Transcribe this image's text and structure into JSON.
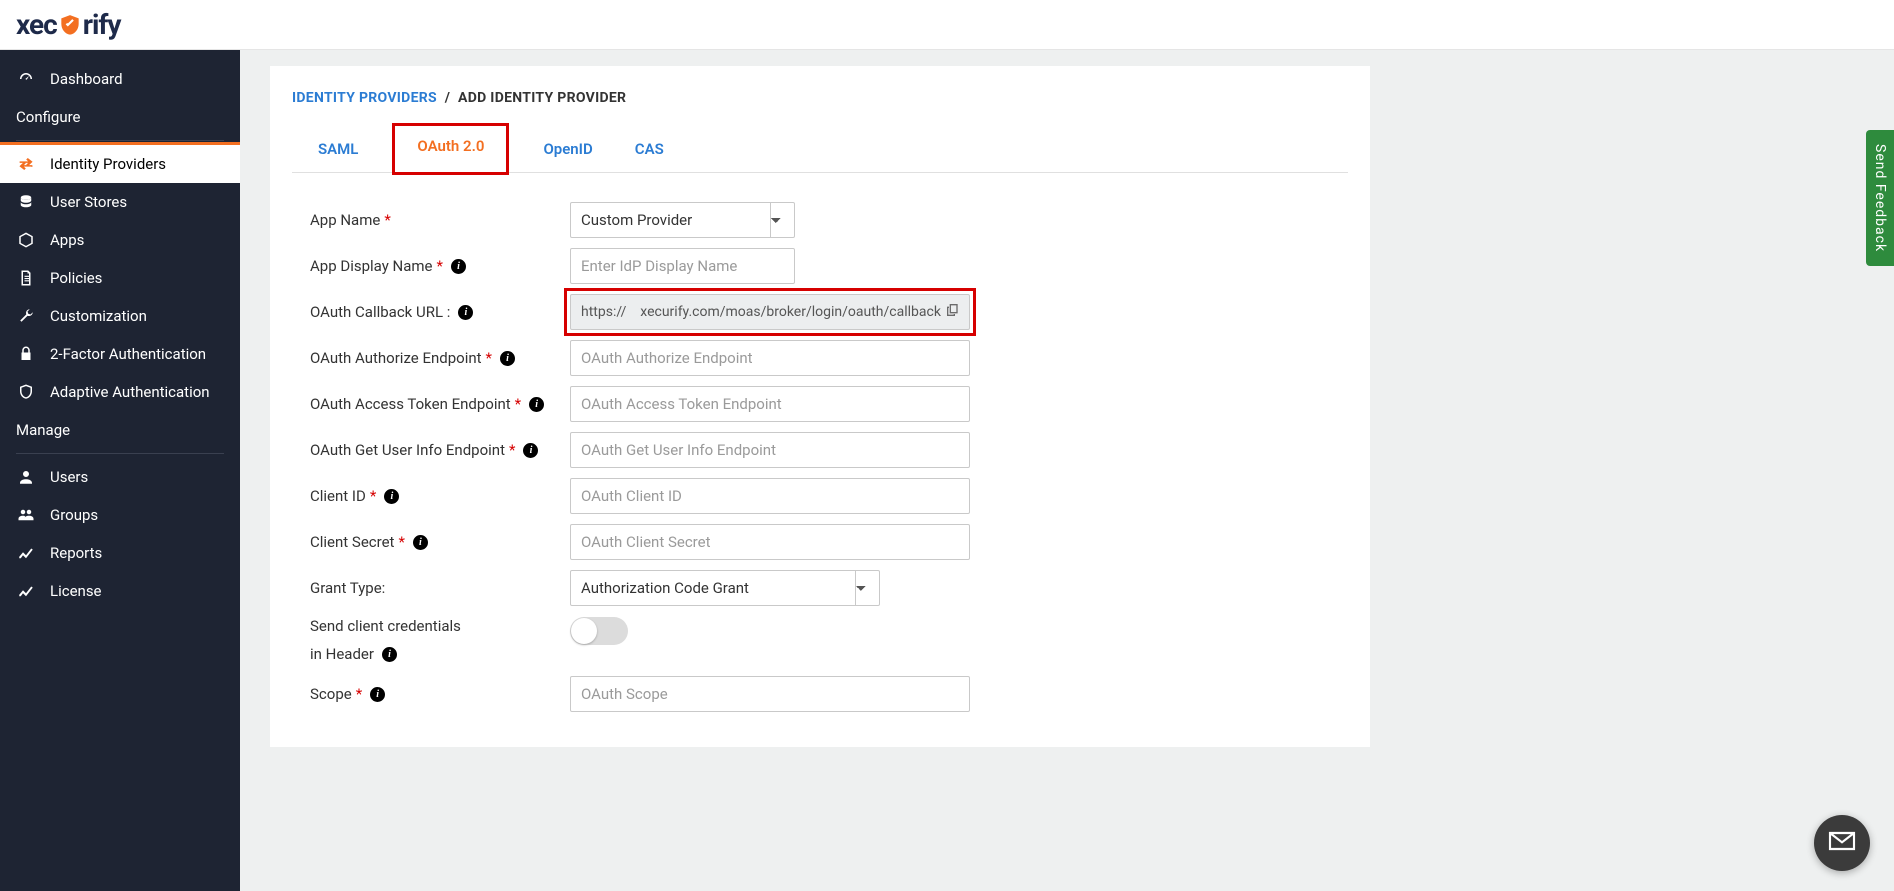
{
  "logo_text_prefix": "xec",
  "logo_text_suffix": "rify",
  "sidebar": {
    "items": [
      {
        "label": "Dashboard"
      },
      {
        "label": "Identity Providers"
      },
      {
        "label": "User Stores"
      },
      {
        "label": "Apps"
      },
      {
        "label": "Policies"
      },
      {
        "label": "Customization"
      },
      {
        "label": "2-Factor Authentication"
      },
      {
        "label": "Adaptive Authentication"
      },
      {
        "label": "Users"
      },
      {
        "label": "Groups"
      },
      {
        "label": "Reports"
      },
      {
        "label": "License"
      }
    ],
    "section_configure": "Configure",
    "section_manage": "Manage"
  },
  "breadcrumb": {
    "link": "IDENTITY PROVIDERS",
    "sep": "/",
    "current": "ADD IDENTITY PROVIDER"
  },
  "tabs": {
    "saml": "SAML",
    "oauth": "OAuth 2.0",
    "openid": "OpenID",
    "cas": "CAS"
  },
  "form": {
    "app_name_label": "App Name",
    "app_name_selected": "Custom Provider",
    "display_name_label": "App Display Name",
    "display_name_placeholder": "Enter IdP Display Name",
    "callback_label": "OAuth Callback URL :",
    "callback_value": "https://    xecurify.com/moas/broker/login/oauth/callback",
    "authorize_label": "OAuth Authorize Endpoint",
    "authorize_placeholder": "OAuth Authorize Endpoint",
    "token_label": "OAuth Access Token Endpoint",
    "token_placeholder": "OAuth Access Token Endpoint",
    "userinfo_label": "OAuth Get User Info Endpoint",
    "userinfo_placeholder": "OAuth Get User Info Endpoint",
    "clientid_label": "Client ID",
    "clientid_placeholder": "OAuth Client ID",
    "secret_label": "Client Secret",
    "secret_placeholder": "OAuth Client Secret",
    "grant_label": "Grant Type:",
    "grant_selected": "Authorization Code Grant",
    "creds_header_label_line1": "Send client credentials",
    "creds_header_label_line2": "in Header",
    "scope_label": "Scope",
    "scope_placeholder": "OAuth Scope"
  },
  "feedback_label": "Send Feedback"
}
